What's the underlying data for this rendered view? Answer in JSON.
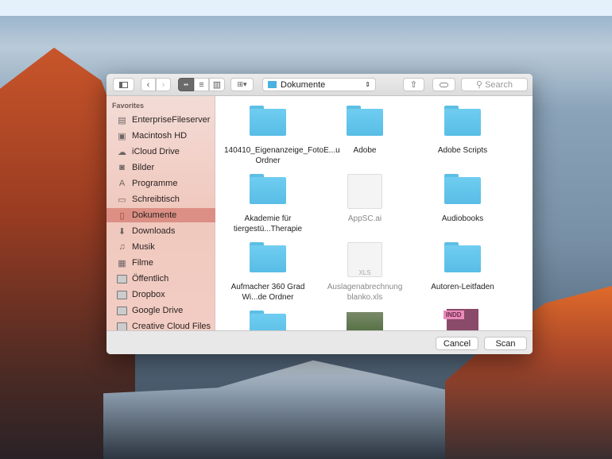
{
  "toolbar": {
    "location": "Dokumente",
    "search_placeholder": "Search"
  },
  "sidebar": {
    "heading": "Favorites",
    "items": [
      {
        "label": "EnterpriseFileserver",
        "icon": "server-icon"
      },
      {
        "label": "Macintosh HD",
        "icon": "harddisk-icon"
      },
      {
        "label": "iCloud Drive",
        "icon": "cloud-icon"
      },
      {
        "label": "Bilder",
        "icon": "camera-icon"
      },
      {
        "label": "Programme",
        "icon": "applications-icon"
      },
      {
        "label": "Schreibtisch",
        "icon": "desktop-icon"
      },
      {
        "label": "Dokumente",
        "icon": "documents-icon",
        "active": true
      },
      {
        "label": "Downloads",
        "icon": "download-icon"
      },
      {
        "label": "Musik",
        "icon": "music-icon"
      },
      {
        "label": "Filme",
        "icon": "film-icon"
      },
      {
        "label": "Öffentlich",
        "icon": "folder-icon"
      },
      {
        "label": "Dropbox",
        "icon": "folder-icon"
      },
      {
        "label": "Google Drive",
        "icon": "folder-icon"
      },
      {
        "label": "Creative Cloud Files",
        "icon": "folder-icon"
      }
    ]
  },
  "files": [
    {
      "name": "140410_Eigenanzeige_FotoE...u Ordner",
      "type": "folder"
    },
    {
      "name": "Adobe",
      "type": "folder"
    },
    {
      "name": "Adobe Scripts",
      "type": "folder"
    },
    {
      "name": "Akademie für tiergestü...Therapie",
      "type": "folder"
    },
    {
      "name": "AppSC.ai",
      "type": "file"
    },
    {
      "name": "Audiobooks",
      "type": "folder"
    },
    {
      "name": "Aufmacher 360 Grad Wi...de Ordner",
      "type": "folder"
    },
    {
      "name": "Auslagenabrechnung blanko.xls",
      "type": "file",
      "badge": "XLS"
    },
    {
      "name": "Autoren-Leitfaden",
      "type": "folder"
    }
  ],
  "partial_badge": "INDD",
  "buttons": {
    "cancel": "Cancel",
    "scan": "Scan"
  }
}
